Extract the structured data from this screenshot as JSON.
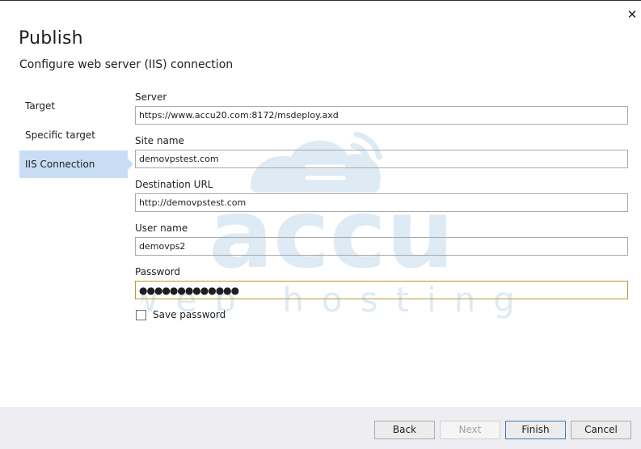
{
  "window": {
    "close_glyph": "✕"
  },
  "header": {
    "title": "Publish",
    "subtitle": "Configure web server (IIS) connection"
  },
  "nav": {
    "items": [
      {
        "label": "Target",
        "active": false
      },
      {
        "label": "Specific target",
        "active": false
      },
      {
        "label": "IIS Connection",
        "active": true
      }
    ]
  },
  "form": {
    "server": {
      "label": "Server",
      "value": "https://www.accu20.com:8172/msdeploy.axd"
    },
    "site_name": {
      "label": "Site name",
      "value": "demovpstest.com"
    },
    "destination_url": {
      "label": "Destination URL",
      "value": "http://demovpstest.com"
    },
    "user_name": {
      "label": "User name",
      "value": "demovps2"
    },
    "password": {
      "label": "Password",
      "value": "●●●●●●●●●●●●●"
    },
    "save_password": {
      "label": "Save password",
      "checked": false
    }
  },
  "watermark": {
    "brand": "accu",
    "tagline": "web hosting"
  },
  "footer": {
    "back_label": "Back",
    "next_label": "Next",
    "finish_label": "Finish",
    "cancel_label": "Cancel"
  },
  "colors": {
    "accent": "#c9def5",
    "focus_border": "#b99a2c",
    "default_button_border": "#3c7fb1",
    "footer_bg": "#eeeef2"
  }
}
